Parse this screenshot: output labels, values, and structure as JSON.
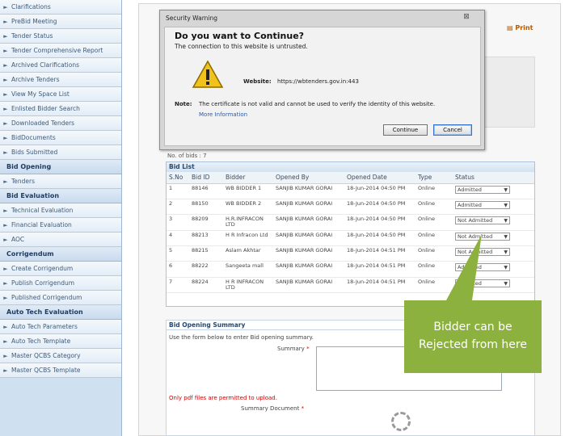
{
  "sidebar": {
    "items_top": [
      "Clarifications",
      "PreBid Meeting",
      "Tender Status",
      "Tender Comprehensive Report",
      "Archived Clarifications",
      "Archive Tenders",
      "View My Space List",
      "Enlisted Bidder Search",
      "Downloaded Tenders",
      "BidDocuments",
      "Bids Submitted"
    ],
    "bid_opening": {
      "title": "Bid Opening",
      "items": [
        "Tenders"
      ]
    },
    "bid_evaluation": {
      "title": "Bid Evaluation",
      "items": [
        "Technical Evaluation",
        "Financial Evaluation",
        "AOC"
      ]
    },
    "corrigendum": {
      "title": "Corrigendum",
      "items": [
        "Create Corrigendum",
        "Publish Corrigendum",
        "Published Corrigendum"
      ]
    },
    "auto_tech": {
      "title": "Auto Tech Evaluation",
      "items": [
        "Auto Tech Parameters",
        "Auto Tech Template",
        "Master QCBS Category",
        "Master QCBS Template"
      ]
    }
  },
  "header": {
    "print_label": "Print"
  },
  "bid_list": {
    "count_label": "No. of bids : 7",
    "title": "Bid List",
    "columns": [
      "S.No",
      "Bid ID",
      "Bidder",
      "Opened By",
      "Opened Date",
      "Type",
      "Status"
    ],
    "rows": [
      {
        "sno": "1",
        "bid_id": "88146",
        "bidder": "WB BIDDER 1",
        "opened_by": "SANJIB KUMAR GORAI",
        "opened_date": "18-Jun-2014 04:50 PM",
        "type": "Online",
        "status": "Admitted"
      },
      {
        "sno": "2",
        "bid_id": "88150",
        "bidder": "WB BIDDER 2",
        "opened_by": "SANJIB KUMAR GORAI",
        "opened_date": "18-Jun-2014 04:50 PM",
        "type": "Online",
        "status": "Admitted"
      },
      {
        "sno": "3",
        "bid_id": "88209",
        "bidder": "H.R.INFRACON LTD",
        "opened_by": "SANJIB KUMAR GORAI",
        "opened_date": "18-Jun-2014 04:50 PM",
        "type": "Online",
        "status": "Not Admitted"
      },
      {
        "sno": "4",
        "bid_id": "88213",
        "bidder": "H R Infracon Ltd",
        "opened_by": "SANJIB KUMAR GORAI",
        "opened_date": "18-Jun-2014 04:50 PM",
        "type": "Online",
        "status": "Not Admitted"
      },
      {
        "sno": "5",
        "bid_id": "88215",
        "bidder": "Aslam Akhtar",
        "opened_by": "SANJIB KUMAR GORAI",
        "opened_date": "18-Jun-2014 04:51 PM",
        "type": "Online",
        "status": "Not Admitted"
      },
      {
        "sno": "6",
        "bid_id": "88222",
        "bidder": "Sangeeta mall",
        "opened_by": "SANJIB KUMAR GORAI",
        "opened_date": "18-Jun-2014 04:51 PM",
        "type": "Online",
        "status": "Admitted"
      },
      {
        "sno": "7",
        "bid_id": "88224",
        "bidder": "H R INFRACON LTD",
        "opened_by": "SANJIB KUMAR GORAI",
        "opened_date": "18-Jun-2014 04:51 PM",
        "type": "Online",
        "status": "Admitted"
      }
    ]
  },
  "summary": {
    "title": "Bid Opening Summary",
    "note": "Use the form below to enter Bid opening summary.",
    "summary_label": "Summary",
    "pdf_note": "Only pdf files are permitted to upload.",
    "doc_label": "Summary Document"
  },
  "dialog": {
    "title": "Security Warning",
    "question": "Do you want to Continue?",
    "subtitle": "The connection to this website is untrusted.",
    "website_label": "Website:",
    "website_value": "https://wbtenders.gov.in:443",
    "note_label": "Note:",
    "note_text": "The certificate is not valid and cannot be used to verify the identity of this website.",
    "more_info": "More Information",
    "continue_label": "Continue",
    "cancel_label": "Cancel"
  },
  "callout": {
    "line1": "Bidder can be",
    "line2": "Rejected from here",
    "color": "#8cb13f"
  }
}
